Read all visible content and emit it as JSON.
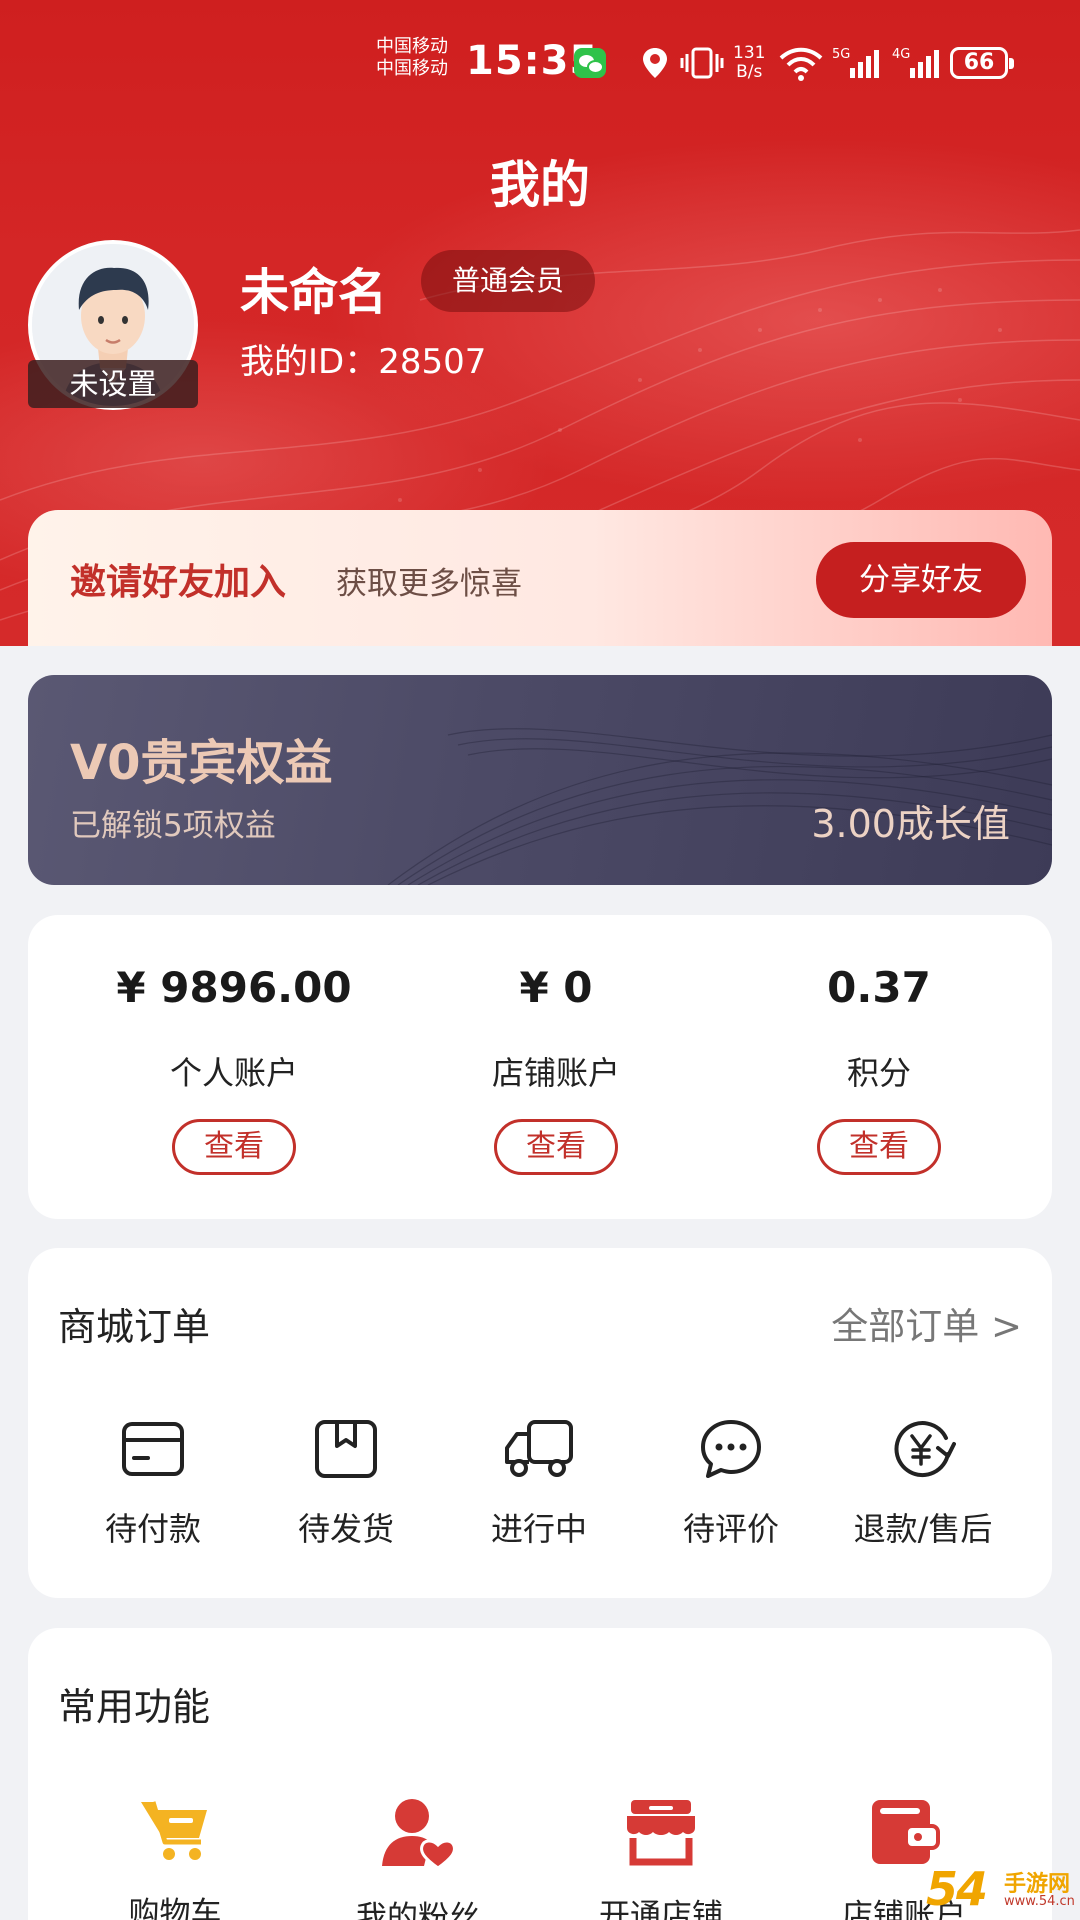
{
  "status_bar": {
    "carrier_1": "中国移动",
    "carrier_2": "中国移动",
    "time": "15:35",
    "net_speed_value": "131",
    "net_speed_unit": "B/s",
    "battery": "66",
    "icons": [
      "wechat-icon",
      "location-icon",
      "vibrate-icon",
      "wifi-icon",
      "signal-5g-icon",
      "signal-4g-icon",
      "battery-icon"
    ]
  },
  "header": {
    "title": "我的"
  },
  "profile": {
    "avatar_tag": "未设置",
    "name": "未命名",
    "member_level": "普通会员",
    "id_text": "我的ID：28507"
  },
  "invite": {
    "title": "邀请好友加入",
    "subtitle": "获取更多惊喜",
    "button": "分享好友"
  },
  "vip": {
    "title": "V0贵宾权益",
    "subtitle": "已解锁5项权益",
    "growth": "3.00成长值"
  },
  "accounts": [
    {
      "value": "¥ 9896.00",
      "label": "个人账户",
      "button": "查看"
    },
    {
      "value": "¥ 0",
      "label": "店铺账户",
      "button": "查看"
    },
    {
      "value": "0.37",
      "label": "积分",
      "button": "查看"
    }
  ],
  "orders": {
    "title": "商城订单",
    "all_link": "全部订单 >",
    "items": [
      {
        "label": "待付款",
        "icon": "card-icon"
      },
      {
        "label": "待发货",
        "icon": "package-icon"
      },
      {
        "label": "进行中",
        "icon": "truck-icon"
      },
      {
        "label": "待评价",
        "icon": "chat-icon"
      },
      {
        "label": "退款/售后",
        "icon": "refund-icon"
      }
    ]
  },
  "functions": {
    "title": "常用功能",
    "items": [
      {
        "label": "购物车",
        "icon": "cart-icon"
      },
      {
        "label": "我的粉丝",
        "icon": "fans-icon"
      },
      {
        "label": "开通店铺",
        "icon": "shop-icon"
      },
      {
        "label": "店铺账户",
        "icon": "wallet-icon"
      }
    ]
  },
  "watermark": {
    "main": "54",
    "site": "手游网",
    "url": "www.54.cn"
  },
  "colors": {
    "brand_red": "#d42626",
    "accent_red": "#c2302a",
    "cart_yellow": "#f4b322",
    "vip_bg": "#4c4a66"
  }
}
